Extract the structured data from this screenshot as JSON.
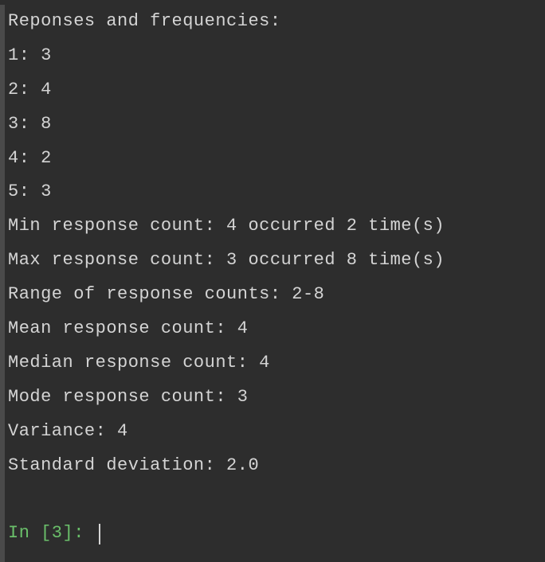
{
  "output": {
    "header": "Reponses and frequencies:",
    "frequencies": [
      {
        "key": "1",
        "value": "3"
      },
      {
        "key": "2",
        "value": "4"
      },
      {
        "key": "3",
        "value": "8"
      },
      {
        "key": "4",
        "value": "2"
      },
      {
        "key": "5",
        "value": "3"
      }
    ],
    "min_line": "Min response count: 4 occurred 2 time(s)",
    "max_line": "Max response count: 3 occurred 8 time(s)",
    "range_line": "Range of response counts: 2-8",
    "mean_line": "Mean response count: 4",
    "median_line": "Median response count: 4",
    "mode_line": "Mode response count: 3",
    "variance_line": "Variance: 4",
    "stddev_line": "Standard deviation: 2.0"
  },
  "prompt": {
    "text": "In [3]: "
  }
}
